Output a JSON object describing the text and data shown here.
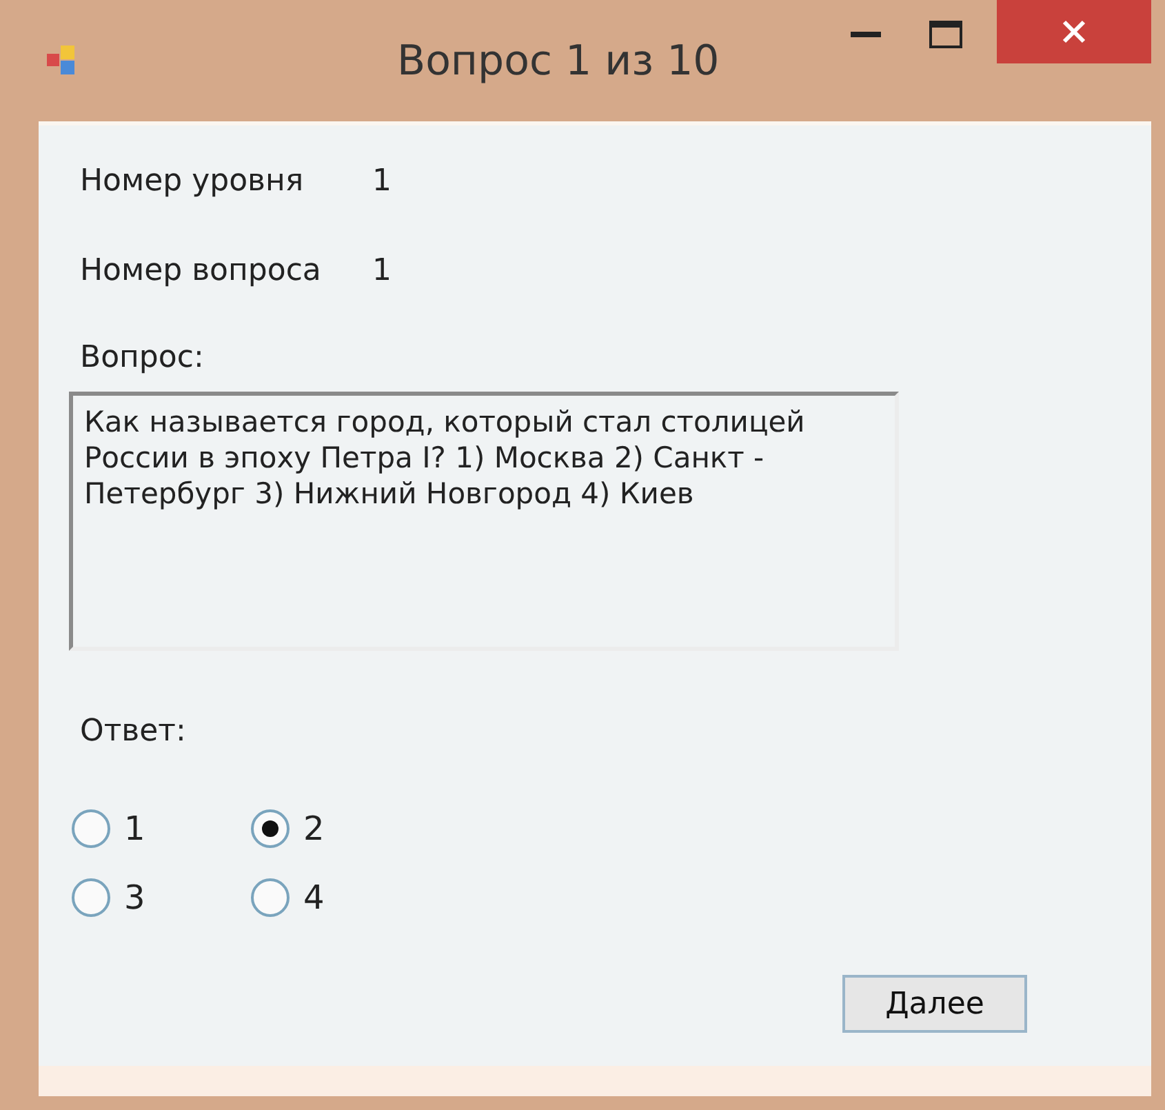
{
  "window": {
    "title": "Вопрос 1 из 10"
  },
  "fields": [
    {
      "label": "Номер уровня",
      "value": "1"
    },
    {
      "label": "Номер вопроса",
      "value": "1"
    }
  ],
  "question": {
    "label": "Вопрос:",
    "text": "Как называется город, который стал столицей России в эпоху Петра I? 1) Москва 2) Санкт - Петербург 3) Нижний Новгород 4) Киев"
  },
  "answer": {
    "label": "Ответ:",
    "options": [
      {
        "label": "1",
        "selected": false
      },
      {
        "label": "2",
        "selected": true
      },
      {
        "label": "3",
        "selected": false
      },
      {
        "label": "4",
        "selected": false
      }
    ]
  },
  "buttons": [
    "Далее"
  ]
}
